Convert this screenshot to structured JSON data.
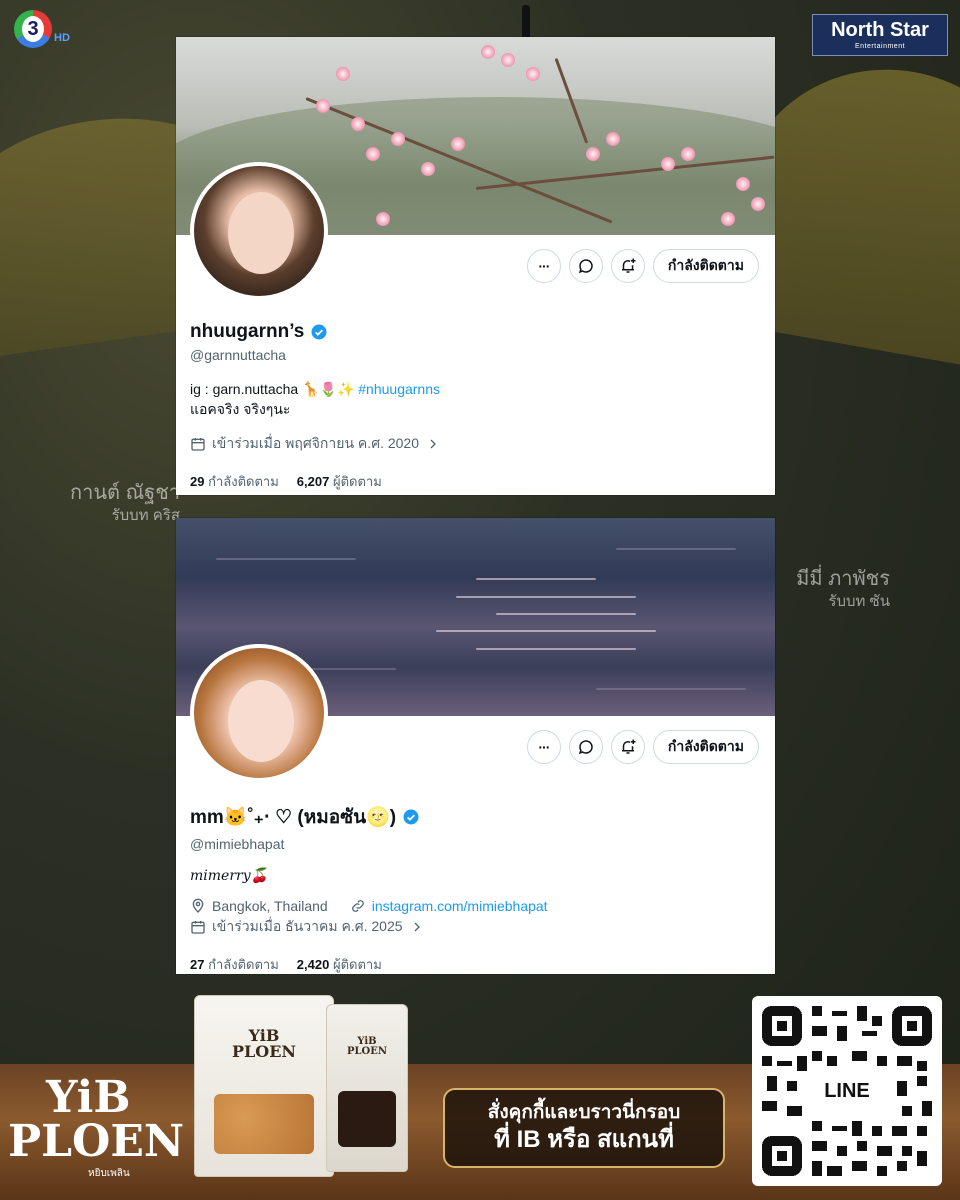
{
  "background": {
    "channel_logo": {
      "number": "3",
      "suffix": "HD"
    },
    "studio_logo": {
      "title": "North Star",
      "subtitle": "Entertainment"
    },
    "cast": [
      {
        "name": "กานต์ ณัฐชา",
        "role": "รับบท คริส"
      },
      {
        "name": "มีมี่ ภาพัชร",
        "role": "รับบท ซัน"
      }
    ]
  },
  "profiles": [
    {
      "display_name": "nhuugarnn’s",
      "handle": "@garnnuttacha",
      "bio_line1": "ig : garn.nuttacha 🦒🌷✨",
      "bio_hashtag": "#nhuugarnns",
      "bio_line2": "แอคจริง จริงๆนะ",
      "joined": "เข้าร่วมเมื่อ พฤศจิกายน ค.ศ. 2020",
      "following_count": "29",
      "following_label": "กำลังติดตาม",
      "followers_count": "6,207",
      "followers_label": "ผู้ติดตาม",
      "follow_button": "กำลังติดตาม",
      "more_label": "···"
    },
    {
      "display_name": "mm🐱˚₊‧ ♡ (หมอซัน🌝)",
      "handle": "@mimiebhapat",
      "bio": "mimerry🍒",
      "location": "Bangkok, Thailand",
      "website": "instagram.com/mimiebhapat",
      "joined": "เข้าร่วมเมื่อ ธันวาคม ค.ศ. 2025",
      "following_count": "27",
      "following_label": "กำลังติดตาม",
      "followers_count": "2,420",
      "followers_label": "ผู้ติดตาม",
      "follow_button": "กำลังติดตาม",
      "more_label": "···"
    }
  ],
  "ad": {
    "brand_line1": "YiB",
    "brand_line2": "PLOEN",
    "brand_thai": "หยิบเพลิน",
    "pouch1_label": "YiB PLOEN",
    "pouch2_label": "YiB PLOEN",
    "promo_line1": "สั่งคุกกี้และบราวนี่กรอบ",
    "promo_line2": "ที่ IB หรือ  สแกนที่",
    "qr_label": "LINE"
  },
  "colors": {
    "verified": "#1d9bf0",
    "link": "#1d9bf0",
    "text_primary": "#0f1419",
    "text_secondary": "#536471"
  }
}
